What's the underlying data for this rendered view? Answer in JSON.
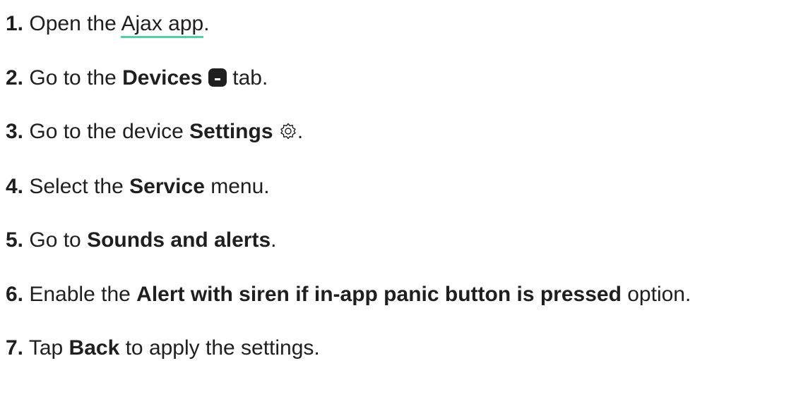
{
  "steps": [
    {
      "number": "1.",
      "parts": {
        "t1": " Open the ",
        "link": "Ajax app",
        "t2": "."
      }
    },
    {
      "number": "2.",
      "parts": {
        "t1": " Go to the ",
        "b1": "Devices",
        "t2": " tab."
      },
      "icon": "devices-icon"
    },
    {
      "number": "3.",
      "parts": {
        "t1": " Go to the device ",
        "b1": "Settings",
        "t2": "."
      },
      "icon": "gear-icon"
    },
    {
      "number": "4.",
      "parts": {
        "t1": " Select the ",
        "b1": "Service",
        "t2": " menu."
      }
    },
    {
      "number": "5.",
      "parts": {
        "t1": " Go to ",
        "b1": "Sounds and alerts",
        "t2": "."
      }
    },
    {
      "number": "6.",
      "parts": {
        "t1": " Enable the ",
        "b1": "Alert with siren if in-app panic button is pressed",
        "t2": " option."
      }
    },
    {
      "number": "7.",
      "parts": {
        "t1": " Tap ",
        "b1": "Back",
        "t2": " to apply the settings."
      }
    }
  ],
  "colors": {
    "text": "#1f1f1f",
    "link_underline": "#4fd1a5"
  }
}
